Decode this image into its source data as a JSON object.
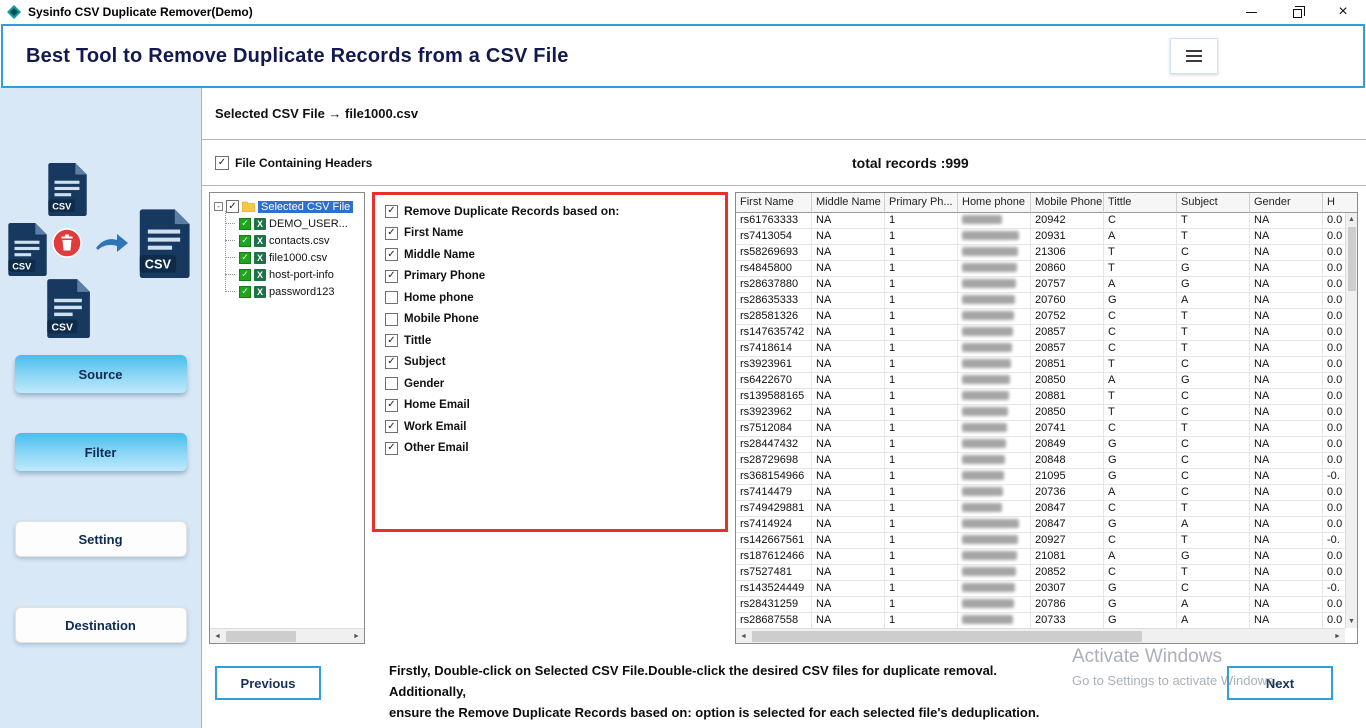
{
  "colors": {
    "accent": "#2f9fe0",
    "sidebar-bg": "#d9e8f6",
    "panel-red": "#e8312a",
    "tree-selection": "#2f6fd0",
    "check-green": "#1da51d"
  },
  "window": {
    "title": "Sysinfo CSV Duplicate Remover(Demo)"
  },
  "header": {
    "title": "Best Tool to Remove Duplicate Records from a CSV File"
  },
  "sidebar": {
    "csv_label": "CSV",
    "buttons": [
      {
        "label": "Source",
        "active": true
      },
      {
        "label": "Filter",
        "active": true
      },
      {
        "label": "Setting",
        "active": false
      },
      {
        "label": "Destination",
        "active": false
      }
    ]
  },
  "main": {
    "selected_file_label": "Selected CSV File → file1000.csv",
    "file_headers": {
      "label": "File Containing Headers",
      "checked": true
    },
    "total_records": "total records :999",
    "tree": {
      "root_label": "Selected CSV File",
      "root_checked": true,
      "items": [
        {
          "label": "DEMO_USER...",
          "checked": true
        },
        {
          "label": "contacts.csv",
          "checked": true
        },
        {
          "label": "file1000.csv",
          "checked": true
        },
        {
          "label": "host-port-info",
          "checked": true
        },
        {
          "label": "password123",
          "checked": true
        }
      ]
    },
    "filter_panel": {
      "title": "Remove Duplicate Records based on:",
      "title_checked": true,
      "options": [
        {
          "label": "First Name",
          "checked": true
        },
        {
          "label": "Middle Name",
          "checked": true
        },
        {
          "label": "Primary Phone",
          "checked": true
        },
        {
          "label": "Home phone",
          "checked": false
        },
        {
          "label": "Mobile Phone",
          "checked": false
        },
        {
          "label": "Tittle",
          "checked": true
        },
        {
          "label": "Subject",
          "checked": true
        },
        {
          "label": "Gender",
          "checked": false
        },
        {
          "label": "Home Email",
          "checked": true
        },
        {
          "label": "Work Email",
          "checked": true
        },
        {
          "label": "Other Email",
          "checked": true
        }
      ]
    },
    "grid": {
      "columns": [
        "First Name",
        "Middle Name",
        "Primary Ph...",
        "Home phone",
        "Mobile Phone",
        "Tittle",
        "Subject",
        "Gender",
        "H"
      ],
      "blurred_column": "Home phone",
      "rows": [
        [
          "rs61763333",
          "NA",
          "1",
          "",
          "20942",
          "C",
          "T",
          "NA",
          "0.0"
        ],
        [
          "rs7413054",
          "NA",
          "1",
          "",
          "20931",
          "A",
          "T",
          "NA",
          "0.0"
        ],
        [
          "rs58269693",
          "NA",
          "1",
          "",
          "21306",
          "T",
          "C",
          "NA",
          "0.0"
        ],
        [
          "rs4845800",
          "NA",
          "1",
          "",
          "20860",
          "T",
          "G",
          "NA",
          "0.0"
        ],
        [
          "rs28637880",
          "NA",
          "1",
          "",
          "20757",
          "A",
          "G",
          "NA",
          "0.0"
        ],
        [
          "rs28635333",
          "NA",
          "1",
          "",
          "20760",
          "G",
          "A",
          "NA",
          "0.0"
        ],
        [
          "rs28581326",
          "NA",
          "1",
          "",
          "20752",
          "C",
          "T",
          "NA",
          "0.0"
        ],
        [
          "rs147635742",
          "NA",
          "1",
          "",
          "20857",
          "C",
          "T",
          "NA",
          "0.0"
        ],
        [
          "rs7418614",
          "NA",
          "1",
          "",
          "20857",
          "C",
          "T",
          "NA",
          "0.0"
        ],
        [
          "rs3923961",
          "NA",
          "1",
          "",
          "20851",
          "T",
          "C",
          "NA",
          "0.0"
        ],
        [
          "rs6422670",
          "NA",
          "1",
          "",
          "20850",
          "A",
          "G",
          "NA",
          "0.0"
        ],
        [
          "rs139588165",
          "NA",
          "1",
          "",
          "20881",
          "T",
          "C",
          "NA",
          "0.0"
        ],
        [
          "rs3923962",
          "NA",
          "1",
          "",
          "20850",
          "T",
          "C",
          "NA",
          "0.0"
        ],
        [
          "rs7512084",
          "NA",
          "1",
          "",
          "20741",
          "C",
          "T",
          "NA",
          "0.0"
        ],
        [
          "rs28447432",
          "NA",
          "1",
          "",
          "20849",
          "G",
          "C",
          "NA",
          "0.0"
        ],
        [
          "rs28729698",
          "NA",
          "1",
          "",
          "20848",
          "G",
          "C",
          "NA",
          "0.0"
        ],
        [
          "rs368154966",
          "NA",
          "1",
          "",
          "21095",
          "G",
          "C",
          "NA",
          "-0."
        ],
        [
          "rs7414479",
          "NA",
          "1",
          "",
          "20736",
          "A",
          "C",
          "NA",
          "0.0"
        ],
        [
          "rs749429881",
          "NA",
          "1",
          "",
          "20847",
          "C",
          "T",
          "NA",
          "0.0"
        ],
        [
          "rs7414924",
          "NA",
          "1",
          "",
          "20847",
          "G",
          "A",
          "NA",
          "0.0"
        ],
        [
          "rs142667561",
          "NA",
          "1",
          "",
          "20927",
          "C",
          "T",
          "NA",
          "-0."
        ],
        [
          "rs187612466",
          "NA",
          "1",
          "",
          "21081",
          "A",
          "G",
          "NA",
          "0.0"
        ],
        [
          "rs7527481",
          "NA",
          "1",
          "",
          "20852",
          "C",
          "T",
          "NA",
          "0.0"
        ],
        [
          "rs143524449",
          "NA",
          "1",
          "",
          "20307",
          "G",
          "C",
          "NA",
          "-0."
        ],
        [
          "rs28431259",
          "NA",
          "1",
          "",
          "20786",
          "G",
          "A",
          "NA",
          "0.0"
        ],
        [
          "rs28687558",
          "NA",
          "1",
          "",
          "20733",
          "G",
          "A",
          "NA",
          "0.0"
        ]
      ]
    }
  },
  "footer": {
    "previous_label": "Previous",
    "next_label": "Next",
    "instruction_line1": "Firstly, Double-click on Selected CSV File.Double-click the desired CSV files for duplicate removal. Additionally,",
    "instruction_line2": "ensure the Remove Duplicate Records based on: option is selected for each selected file's deduplication."
  },
  "watermark": {
    "line1": "Activate Windows",
    "line2": "Go to Settings to activate Windows."
  }
}
